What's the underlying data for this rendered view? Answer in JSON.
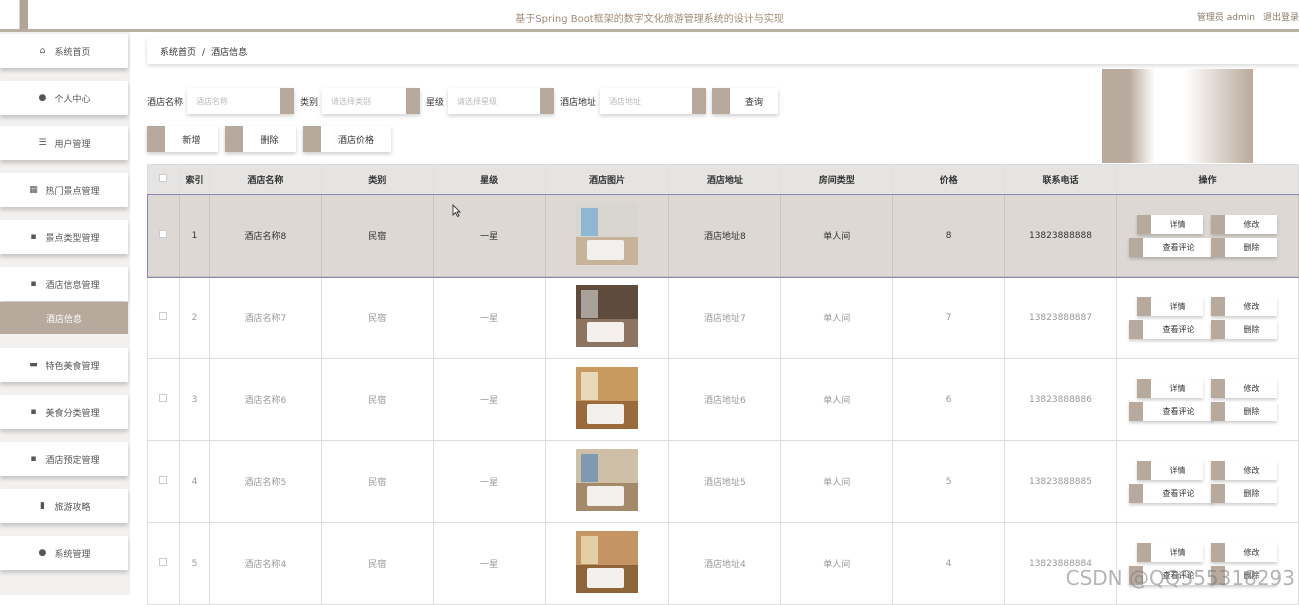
{
  "header": {
    "title": "基于Spring Boot框架的数字文化旅游管理系统的设计与实现",
    "user_role": "管理员 admin",
    "logout": "退出登录"
  },
  "sidebar": {
    "items": [
      {
        "label": "系统首页",
        "icon": "home-icon",
        "glyph": "⌂"
      },
      {
        "label": "个人中心",
        "icon": "user-icon",
        "glyph": "●"
      },
      {
        "label": "用户管理",
        "icon": "sliders-icon",
        "glyph": "☰"
      },
      {
        "label": "热门景点管理",
        "icon": "grid-icon",
        "glyph": "▦"
      },
      {
        "label": "景点类型管理",
        "icon": "apps-icon",
        "glyph": "▪"
      },
      {
        "label": "酒店信息管理",
        "icon": "apps-icon",
        "glyph": "▪"
      },
      {
        "label": "特色美食管理",
        "icon": "bag-icon",
        "glyph": "▬"
      },
      {
        "label": "美食分类管理",
        "icon": "apps-icon",
        "glyph": "▪"
      },
      {
        "label": "酒店预定管理",
        "icon": "apps-icon",
        "glyph": "▪"
      },
      {
        "label": "旅游攻略",
        "icon": "clipboard-icon",
        "glyph": "▮"
      },
      {
        "label": "系统管理",
        "icon": "pin-icon",
        "glyph": "●"
      }
    ],
    "active_sub": "酒店信息"
  },
  "breadcrumb": {
    "home": "系统首页",
    "sep": "/",
    "current": "酒店信息"
  },
  "search": {
    "name_label": "酒店名称",
    "name_placeholder": "酒店名称",
    "type_label": "类别",
    "type_placeholder": "请选择类别",
    "star_label": "星级",
    "star_placeholder": "请选择星级",
    "addr_label": "酒店地址",
    "addr_placeholder": "酒店地址",
    "query": "查询"
  },
  "actions": {
    "add": "新增",
    "delete": "删除",
    "price": "酒店价格"
  },
  "table": {
    "headers": [
      "索引",
      "酒店名称",
      "类别",
      "星级",
      "酒店图片",
      "酒店地址",
      "房间类型",
      "价格",
      "联系电话",
      "操作"
    ],
    "rows": [
      {
        "idx": "1",
        "name": "酒店名称8",
        "type": "民宿",
        "star": "一星",
        "addr": "酒店地址8",
        "room": "单人间",
        "price": "8",
        "phone": "13823888888"
      },
      {
        "idx": "2",
        "name": "酒店名称7",
        "type": "民宿",
        "star": "一星",
        "addr": "酒店地址7",
        "room": "单人间",
        "price": "7",
        "phone": "13823888887"
      },
      {
        "idx": "3",
        "name": "酒店名称6",
        "type": "民宿",
        "star": "一星",
        "addr": "酒店地址6",
        "room": "单人间",
        "price": "6",
        "phone": "13823888886"
      },
      {
        "idx": "4",
        "name": "酒店名称5",
        "type": "民宿",
        "star": "一星",
        "addr": "酒店地址5",
        "room": "单人间",
        "price": "5",
        "phone": "13823888885"
      },
      {
        "idx": "5",
        "name": "酒店名称4",
        "type": "民宿",
        "star": "一星",
        "addr": "酒店地址4",
        "room": "单人间",
        "price": "4",
        "phone": "13823888884"
      }
    ],
    "ops": {
      "detail": "详情",
      "edit": "修改",
      "review": "查看评论",
      "delete": "删除"
    }
  },
  "watermark": "CSDN @QQ355318293",
  "colors": {
    "accent": "#b7aa9d",
    "selected_row": "#ddd8d3"
  }
}
